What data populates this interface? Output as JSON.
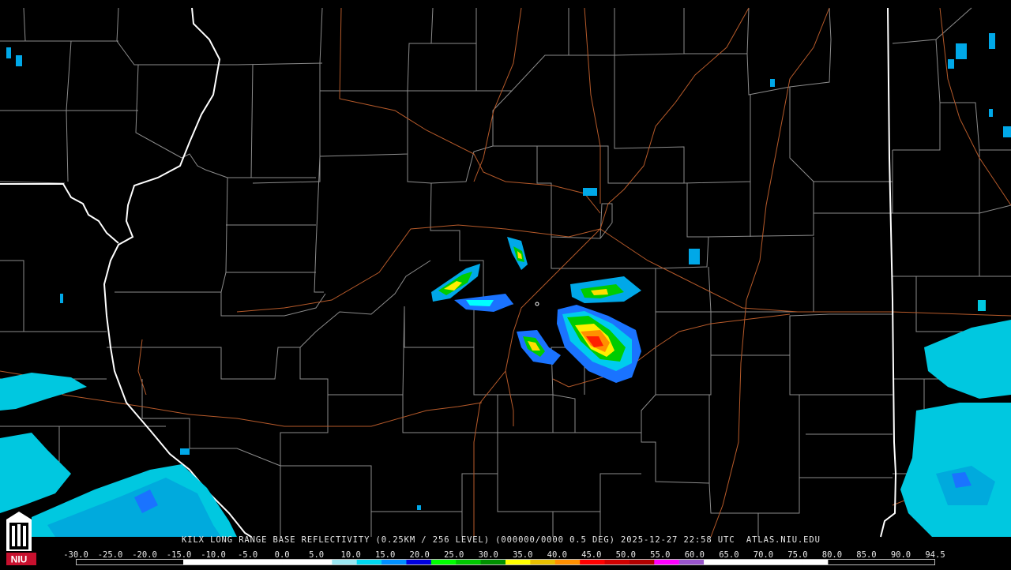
{
  "caption": "KILX LONG RANGE BASE REFLECTIVITY (0.25KM / 256 LEVEL) (000000/0000 0.5 DEG) 2025-12-27 22:58 UTC  ATLAS.NIU.EDU",
  "logo": {
    "text": "NIU",
    "icon": "niu-tower-icon",
    "color": "#c8102e"
  },
  "scale": {
    "labels": [
      "-30.0",
      "-25.0",
      "-20.0",
      "-15.0",
      "-10.0",
      "-5.0",
      "0.0",
      "5.0",
      "10.0",
      "15.0",
      "20.0",
      "25.0",
      "30.0",
      "35.0",
      "40.0",
      "45.0",
      "50.0",
      "55.0",
      "60.0",
      "65.0",
      "70.0",
      "75.0",
      "80.0",
      "85.0",
      "90.0",
      "94.5"
    ],
    "colors": [
      "#ffffff",
      "#ffffff",
      "#ffffff",
      "#ffffff",
      "#ffffff",
      "#ffffff",
      "#9be7f2",
      "#00d8f0",
      "#0090ff",
      "#0000e0",
      "#00ff00",
      "#00c800",
      "#009000",
      "#ffff00",
      "#e8c000",
      "#ff9000",
      "#ff0000",
      "#d00000",
      "#b00000",
      "#ff00ff",
      "#9955cc",
      "#ffffff",
      "#ffffff",
      "#ffffff",
      "#ffffff",
      "#ffffff"
    ]
  },
  "map_colors": {
    "background": "#000000",
    "county": "#8c8c8c",
    "state": "#ffffff",
    "highway": "#b65a2a"
  },
  "radar": {
    "site": "KILX",
    "product": "base reflectivity"
  }
}
